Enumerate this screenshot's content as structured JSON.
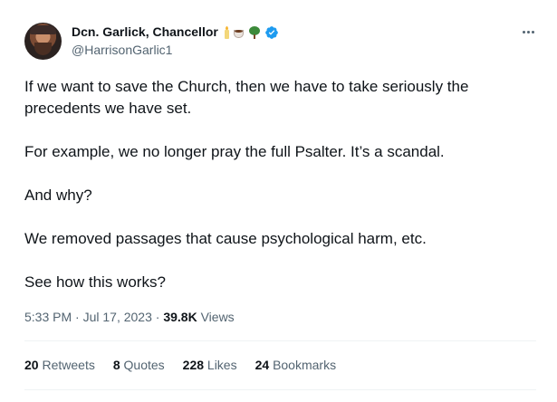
{
  "author": {
    "display_name": "Dcn. Garlick, Chancellor",
    "handle": "@HarrisonGarlic1",
    "emojis": [
      "candle-icon",
      "coffee-icon",
      "tree-icon"
    ],
    "verified": true
  },
  "tweet": {
    "paragraphs": [
      "If we want to save the Church, then we have to take seriously the precedents we have set.",
      "For example, we no longer pray the full Psalter. It’s a scandal.",
      "And why?",
      "We removed passages that cause psychological harm, etc.",
      "See how this works?"
    ]
  },
  "meta": {
    "time": "5:33 PM",
    "separator": " · ",
    "date": "Jul 17, 2023",
    "views_count": "39.8K",
    "views_label": "Views"
  },
  "stats": {
    "retweets_count": "20",
    "retweets_label": "Retweets",
    "quotes_count": "8",
    "quotes_label": "Quotes",
    "likes_count": "228",
    "likes_label": "Likes",
    "bookmarks_count": "24",
    "bookmarks_label": "Bookmarks"
  },
  "colors": {
    "text_primary": "#0f1419",
    "text_secondary": "#536471",
    "verified_blue": "#1d9bf0",
    "divider": "#eff3f4"
  },
  "icons": {
    "more": "more-options-icon",
    "verified": "verified-badge-icon"
  }
}
